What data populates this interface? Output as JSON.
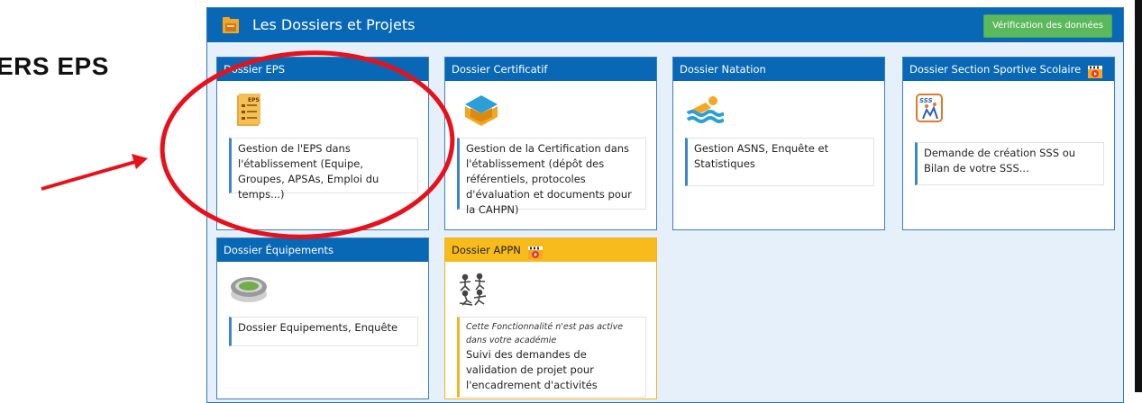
{
  "page_heading": "ERS EPS",
  "panel": {
    "title": "Les Dossiers et Projets",
    "verify_button": "Vérification des données"
  },
  "cards": [
    {
      "title": "Dossier EPS",
      "description": "Gestion de l'EPS dans l'établissement (Equipe, Groupes, APSAs, Emploi du temps...)",
      "icon": "eps-checklist-icon"
    },
    {
      "title": "Dossier Certificatif",
      "description": "Gestion de la Certification dans l'établissement (dépôt des référentiels, protocoles d'évaluation et documents pour la CAHPN)",
      "icon": "graduation-cap-icon"
    },
    {
      "title": "Dossier Natation",
      "description": "Gestion ASNS, Enquête et Statistiques",
      "icon": "swimmer-icon"
    },
    {
      "title": "Dossier Section Sportive Scolaire",
      "description": "Demande de création SSS ou Bilan de votre SSS...",
      "icon": "sss-icon",
      "video_badge": "video-icon"
    },
    {
      "title": "Dossier Équipements",
      "description": "Dossier Equipements, Enquête",
      "icon": "stadium-icon"
    },
    {
      "title": "Dossier APPN",
      "note": "Cette Fonctionnalité n'est pas active dans votre académie",
      "description": "Suivi des demandes de validation de projet pour l'encadrement d'activités",
      "icon": "outdoor-sports-icon",
      "video_badge": "video-icon"
    }
  ],
  "colors": {
    "header_blue": "#0868b5",
    "panel_bg": "#e6f0fa",
    "verify_green": "#5bb85d",
    "appn_yellow": "#f7bb1b",
    "annotation_red": "#e8101a"
  }
}
